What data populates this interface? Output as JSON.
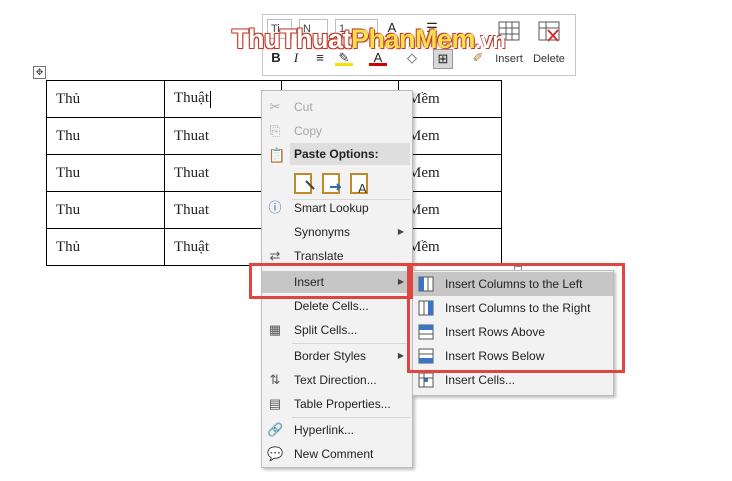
{
  "watermark": {
    "part1": "Thu",
    "part2": "Thuat",
    "part3": "PhanMem",
    "part4": ".vn"
  },
  "mini_toolbar": {
    "font_name": "Ti",
    "style_name": "N",
    "font_size": "1",
    "insert_label": "Insert",
    "delete_label": "Delete"
  },
  "table": {
    "rows": [
      [
        "Thủ",
        "Thuật",
        "",
        "Mềm"
      ],
      [
        "Thu",
        "Thuat",
        "",
        "Mem"
      ],
      [
        "Thu",
        "Thuat",
        "",
        "Mem"
      ],
      [
        "Thu",
        "Thuat",
        "",
        "Mem"
      ],
      [
        "Thủ",
        "Thuật",
        "",
        "Mềm"
      ]
    ]
  },
  "context_menu": {
    "cut": "Cut",
    "copy": "Copy",
    "paste_options": "Paste Options:",
    "smart_lookup": "Smart Lookup",
    "synonyms": "Synonyms",
    "translate": "Translate",
    "insert": "Insert",
    "delete_cells": "Delete Cells...",
    "split_cells": "Split Cells...",
    "border_styles": "Border Styles",
    "text_direction": "Text Direction...",
    "table_properties": "Table Properties...",
    "hyperlink": "Hyperlink...",
    "new_comment": "New Comment"
  },
  "insert_submenu": {
    "cols_left": "Insert Columns to the Left",
    "cols_right": "Insert Columns to the Right",
    "rows_above": "Insert Rows Above",
    "rows_below": "Insert Rows Below",
    "insert_cells": "Insert Cells..."
  },
  "colors": {
    "highlight_box": "#e0453f",
    "menu_bg": "#f2f2f2",
    "menu_hover": "#c6c6c6"
  }
}
